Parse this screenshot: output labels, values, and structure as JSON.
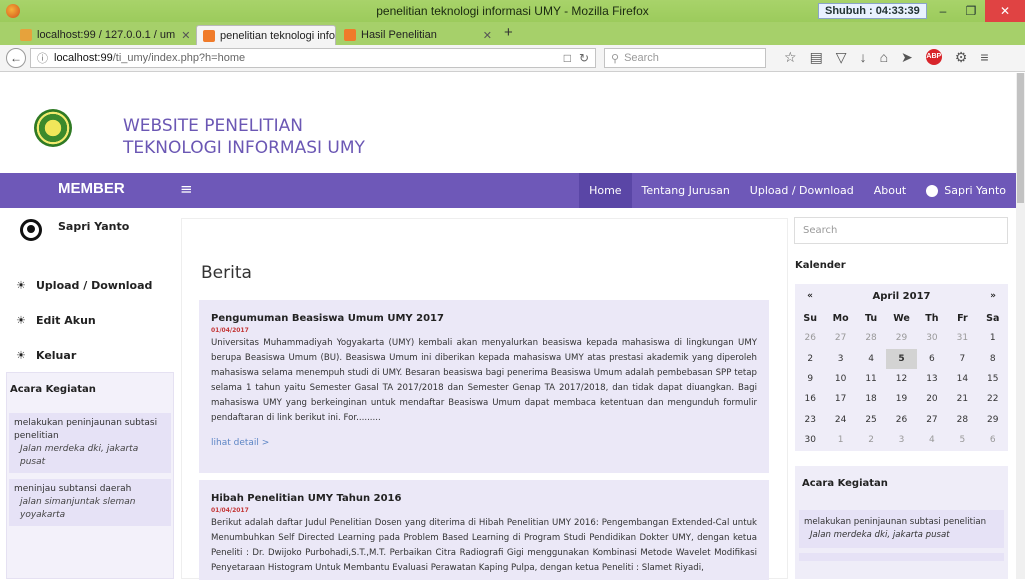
{
  "browser": {
    "window_title": "penelitian teknologi informasi UMY - Mozilla Firefox",
    "timer": "Shubuh : 04:33:39",
    "tabs": [
      {
        "label": "localhost:99 / 127.0.0.1 / um"
      },
      {
        "label": "penelitian teknologi informa"
      },
      {
        "label": "Hasil Penelitian"
      }
    ],
    "url_host": "localhost:99",
    "url_path": "/ti_umy/index.php?h=home",
    "search_placeholder": "Search"
  },
  "site": {
    "title_line1": "WEBSITE PENELITIAN",
    "title_line2": "TEKNOLOGI INFORMASI UMY"
  },
  "topnav": {
    "member": "MEMBER",
    "links": [
      "Home",
      "Tentang Jurusan",
      "Upload / Download",
      "About"
    ],
    "user": "Sapri Yanto"
  },
  "left": {
    "user": "Sapri Yanto",
    "menu": [
      "Upload / Download",
      "Edit Akun",
      "Keluar"
    ],
    "acara_title": "Acara Kegiatan",
    "acara": [
      {
        "title": "melakukan peninjaunan subtasi penelitian",
        "place": "Jalan merdeka dki, jakarta pusat"
      },
      {
        "title": "meninjau subtansi daerah",
        "place": "jalan simanjuntak sleman yoyakarta"
      }
    ]
  },
  "main": {
    "title": "Berita",
    "news": [
      {
        "title": "Pengumuman Beasiswa Umum UMY 2017",
        "date": "01/04/2017",
        "body": "Universitas Muhammadiyah Yogyakarta (UMY) kembali akan menyalurkan beasiswa kepada mahasiswa di lingkungan UMY berupa Beasiswa Umum (BU). Beasiswa Umum ini diberikan kepada mahasiswa UMY atas prestasi akademik yang diperoleh mahasiswa selama menempuh studi di UMY. Besaran beasiswa bagi penerima Beasiswa Umum adalah pembebasan SPP tetap selama 1 tahun yaitu Semester Gasal TA 2017/2018 dan Semester Genap TA 2017/2018, dan tidak dapat diuangkan. Bagi mahasiswa UMY yang berkeinginan untuk mendaftar Beasiswa Umum dapat membaca ketentuan dan mengunduh formulir pendaftaran di link berikut ini. For.........",
        "more": "lihat detail >"
      },
      {
        "title": "Hibah Penelitian UMY Tahun 2016",
        "date": "01/04/2017",
        "body": "Berikut adalah daftar Judul Penelitian Dosen yang diterima di Hibah Penelitian UMY 2016: Pengembangan Extended-Cal untuk Menumbuhkan Self Directed Learning pada Problem Based Learning di Program Studi Pendidikan Dokter UMY, dengan ketua Peneliti : Dr. Dwijoko Purbohadi,S.T.,M.T. Perbaikan Citra Radiografi Gigi menggunakan Kombinasi Metode Wavelet Modifikasi Penyetaraan Histogram Untuk Membantu Evaluasi Perawatan Kaping Pulpa, dengan ketua Peneliti : Slamet Riyadi,"
      }
    ]
  },
  "right": {
    "search_placeholder": "Search",
    "kalender": "Kalender",
    "month": "April 2017",
    "prev": "«",
    "next": "»",
    "dow": [
      "Su",
      "Mo",
      "Tu",
      "We",
      "Th",
      "Fr",
      "Sa"
    ],
    "days": [
      "26",
      "27",
      "28",
      "29",
      "30",
      "31",
      "1",
      "2",
      "3",
      "4",
      "5",
      "6",
      "7",
      "8",
      "9",
      "10",
      "11",
      "12",
      "13",
      "14",
      "15",
      "16",
      "17",
      "18",
      "19",
      "20",
      "21",
      "22",
      "23",
      "24",
      "25",
      "26",
      "27",
      "28",
      "29",
      "30",
      "1",
      "2",
      "3",
      "4",
      "5",
      "6"
    ],
    "acara_title": "Acara Kegiatan",
    "acara_item": "melakukan peninjaunan subtasi penelitian",
    "acara_place": "Jalan merdeka dki, jakarta pusat"
  }
}
